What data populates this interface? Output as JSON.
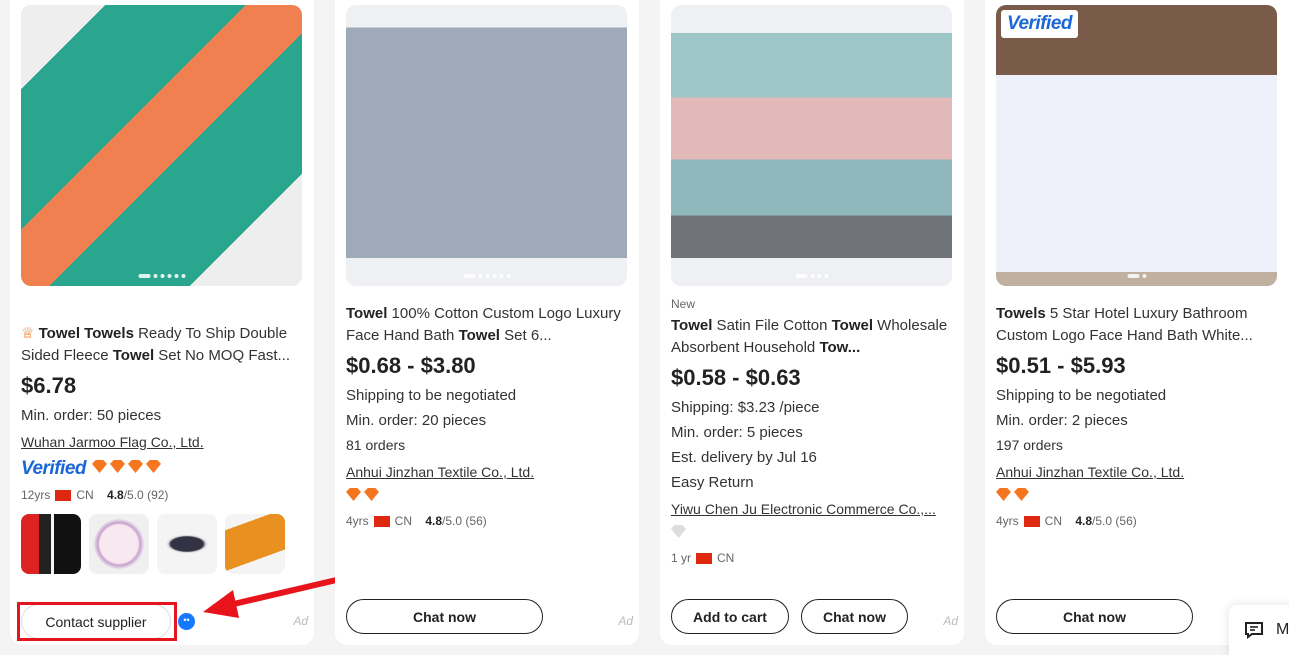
{
  "products": [
    {
      "title_parts": [
        {
          "t": "Towel Towels",
          "b": true
        },
        {
          "t": " Ready To Ship Double Sided Fleece ",
          "b": false
        },
        {
          "t": "Towel",
          "b": true
        },
        {
          "t": " Set No MOQ Fast...",
          "b": false
        }
      ],
      "price": "$6.78",
      "lines": [
        "Min. order: 50 pieces"
      ],
      "supplier": "Wuhan Jarmoo Flag Co., Ltd.",
      "verified": "Verified",
      "diamonds": 4,
      "years": "12yrs",
      "country": "CN",
      "rating": "4.8",
      "rating_rest": "/5.0 (92)",
      "button": "Contact supplier",
      "ad": "Ad"
    },
    {
      "title_parts": [
        {
          "t": "Towel",
          "b": true
        },
        {
          "t": " 100% Cotton Custom Logo Luxury Face Hand Bath ",
          "b": false
        },
        {
          "t": "Towel",
          "b": true
        },
        {
          "t": " Set 6...",
          "b": false
        }
      ],
      "price": "$0.68 - $3.80",
      "lines": [
        "Shipping to be negotiated",
        "Min. order: 20 pieces"
      ],
      "orders": "81 orders",
      "supplier": "Anhui Jinzhan Textile Co., Ltd.",
      "diamonds": 2,
      "years": "4yrs",
      "country": "CN",
      "rating": "4.8",
      "rating_rest": "/5.0 (56)",
      "button": "Chat now",
      "ad": "Ad"
    },
    {
      "badge": "New",
      "title_parts": [
        {
          "t": "Towel",
          "b": true
        },
        {
          "t": " Satin File Cotton ",
          "b": false
        },
        {
          "t": "Towel",
          "b": true
        },
        {
          "t": " Wholesale Absorbent Household ",
          "b": false
        },
        {
          "t": "Tow...",
          "b": true
        }
      ],
      "price": "$0.58 - $0.63",
      "lines": [
        "Shipping: $3.23 /piece",
        "Min. order: 5 pieces",
        "Est. delivery by Jul 16",
        "Easy Return"
      ],
      "supplier": "Yiwu Chen Ju Electronic Commerce Co.,...",
      "diamonds": 1,
      "years": "1 yr",
      "country": "CN",
      "button": "Chat now",
      "button2": "Add to cart",
      "ad": "Ad"
    },
    {
      "verified_badge": "Verified",
      "title_parts": [
        {
          "t": "Towels",
          "b": true
        },
        {
          "t": " 5 Star Hotel Luxury Bathroom Custom Logo Face Hand Bath White...",
          "b": false
        }
      ],
      "price": "$0.51 - $5.93",
      "lines": [
        "Shipping to be negotiated",
        "Min. order: 2 pieces"
      ],
      "orders": "197 orders",
      "supplier": "Anhui Jinzhan Textile Co., Ltd.",
      "diamonds": 2,
      "years": "4yrs",
      "country": "CN",
      "rating": "4.8",
      "rating_rest": "/5.0 (56)",
      "button": "Chat now"
    }
  ],
  "messenger": {
    "label": "M",
    "icon": "message-icon"
  },
  "annotation": {
    "color": "#e8141b"
  }
}
